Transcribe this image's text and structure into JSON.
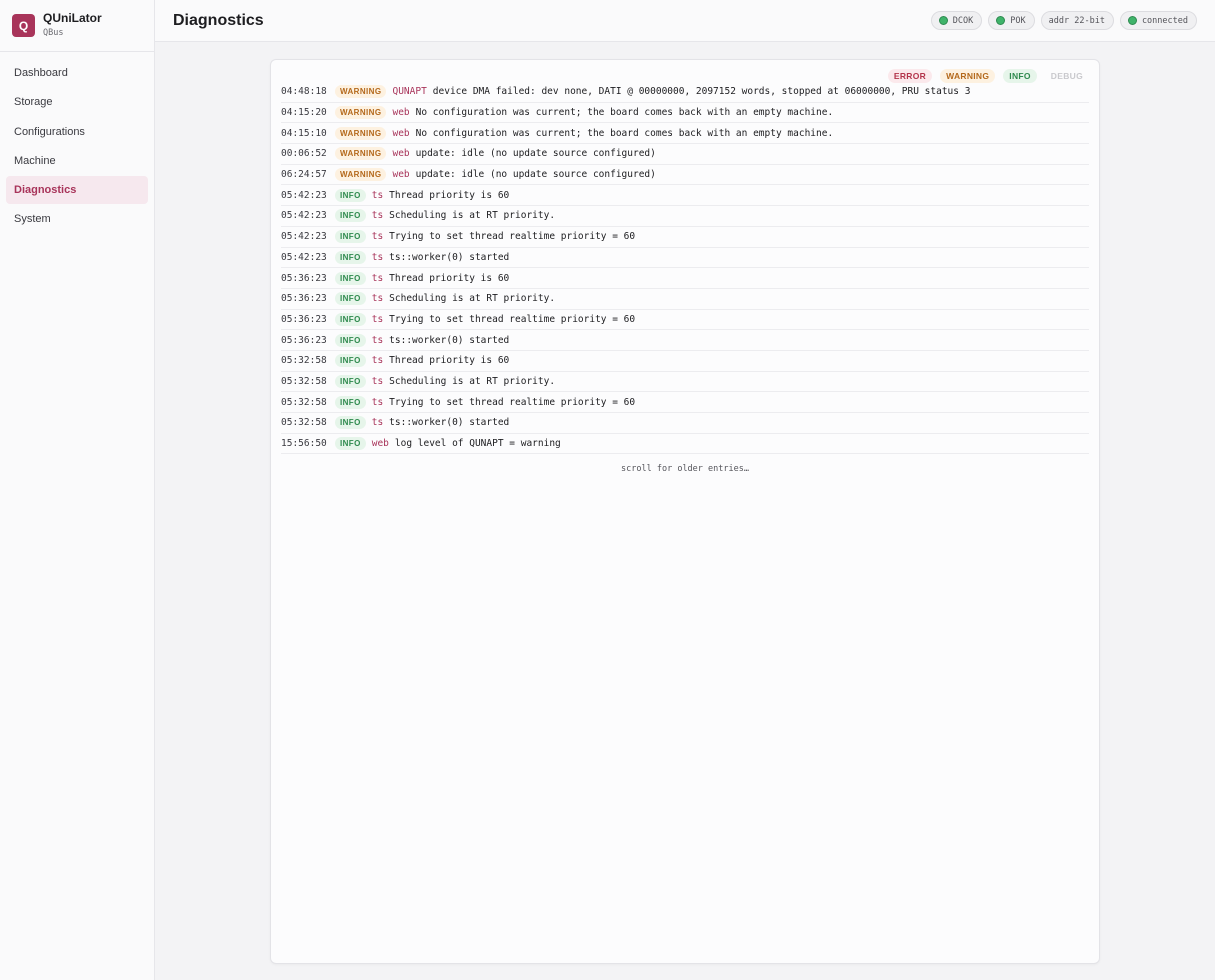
{
  "app": {
    "logo_letter": "Q",
    "title": "QUniLator",
    "subtitle": "QBus",
    "accent_color": "#a8345a"
  },
  "sidebar": {
    "items": [
      {
        "label": "Dashboard",
        "active": false
      },
      {
        "label": "Storage",
        "active": false
      },
      {
        "label": "Configurations",
        "active": false
      },
      {
        "label": "Machine",
        "active": false
      },
      {
        "label": "Diagnostics",
        "active": true
      },
      {
        "label": "System",
        "active": false
      }
    ]
  },
  "header": {
    "title": "Diagnostics",
    "status": [
      {
        "label": "DCOK",
        "indicator": "green"
      },
      {
        "label": "POK",
        "indicator": "green"
      },
      {
        "label": "addr 22-bit",
        "indicator": "none"
      },
      {
        "label": "connected",
        "indicator": "green"
      }
    ]
  },
  "filters": [
    {
      "label": "ERROR",
      "enabled": true
    },
    {
      "label": "WARNING",
      "enabled": true
    },
    {
      "label": "INFO",
      "enabled": true
    },
    {
      "label": "DEBUG",
      "enabled": false
    }
  ],
  "log": [
    {
      "time": "04:48:18",
      "level": "WARNING",
      "source": "QUNAPT",
      "message": "device DMA failed: dev none, DATI @ 00000000, 2097152 words, stopped at 06000000, PRU status 3"
    },
    {
      "time": "04:15:20",
      "level": "WARNING",
      "source": "web",
      "message": "No configuration was current; the board comes back with an empty machine."
    },
    {
      "time": "04:15:10",
      "level": "WARNING",
      "source": "web",
      "message": "No configuration was current; the board comes back with an empty machine."
    },
    {
      "time": "00:06:52",
      "level": "WARNING",
      "source": "web",
      "message": "update: idle (no update source configured)"
    },
    {
      "time": "06:24:57",
      "level": "WARNING",
      "source": "web",
      "message": "update: idle (no update source configured)"
    },
    {
      "time": "05:42:23",
      "level": "INFO",
      "source": "ts",
      "message": "Thread priority is 60"
    },
    {
      "time": "05:42:23",
      "level": "INFO",
      "source": "ts",
      "message": "Scheduling is at RT priority."
    },
    {
      "time": "05:42:23",
      "level": "INFO",
      "source": "ts",
      "message": "Trying to set thread realtime priority = 60"
    },
    {
      "time": "05:42:23",
      "level": "INFO",
      "source": "ts",
      "message": "ts::worker(0) started"
    },
    {
      "time": "05:36:23",
      "level": "INFO",
      "source": "ts",
      "message": "Thread priority is 60"
    },
    {
      "time": "05:36:23",
      "level": "INFO",
      "source": "ts",
      "message": "Scheduling is at RT priority."
    },
    {
      "time": "05:36:23",
      "level": "INFO",
      "source": "ts",
      "message": "Trying to set thread realtime priority = 60"
    },
    {
      "time": "05:36:23",
      "level": "INFO",
      "source": "ts",
      "message": "ts::worker(0) started"
    },
    {
      "time": "05:32:58",
      "level": "INFO",
      "source": "ts",
      "message": "Thread priority is 60"
    },
    {
      "time": "05:32:58",
      "level": "INFO",
      "source": "ts",
      "message": "Scheduling is at RT priority."
    },
    {
      "time": "05:32:58",
      "level": "INFO",
      "source": "ts",
      "message": "Trying to set thread realtime priority = 60"
    },
    {
      "time": "05:32:58",
      "level": "INFO",
      "source": "ts",
      "message": "ts::worker(0) started"
    },
    {
      "time": "15:56:50",
      "level": "INFO",
      "source": "web",
      "message": "log level of QUNAPT = warning"
    }
  ],
  "more_text": "scroll for older entries…"
}
